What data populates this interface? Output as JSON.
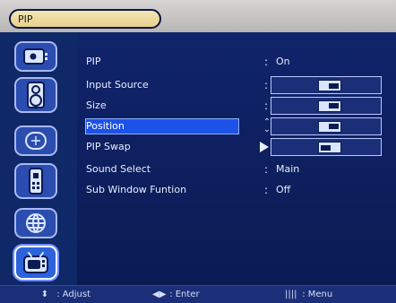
{
  "header": {
    "title": "PIP"
  },
  "sidebar": {
    "icons": [
      {
        "name": "picture-icon"
      },
      {
        "name": "sound-icon"
      },
      {
        "name": "setup-icon"
      },
      {
        "name": "input-icon"
      },
      {
        "name": "globe-icon"
      },
      {
        "name": "pip-icon"
      }
    ]
  },
  "menu": {
    "items": [
      {
        "label": "PIP",
        "sep": ":",
        "value": "On"
      },
      {
        "label": "Input Source",
        "sep": ":",
        "value": ""
      },
      {
        "label": "Size",
        "sep": ":",
        "value": ""
      },
      {
        "label": "Position",
        "sep": "",
        "value": ""
      },
      {
        "label": "PIP Swap",
        "sep": "",
        "value": ""
      },
      {
        "label": "Sound Select",
        "sep": ":",
        "value": "Main"
      },
      {
        "label": "Sub Window Funtion",
        "sep": ":",
        "value": "Off"
      }
    ]
  },
  "help": {
    "adjust": {
      "icon": "up-down-icon",
      "text": ": Adjust"
    },
    "enter": {
      "icon": "left-right-icon",
      "text": ": Enter"
    },
    "menu": {
      "icon": "menu-icon",
      "text": ": Menu"
    }
  }
}
